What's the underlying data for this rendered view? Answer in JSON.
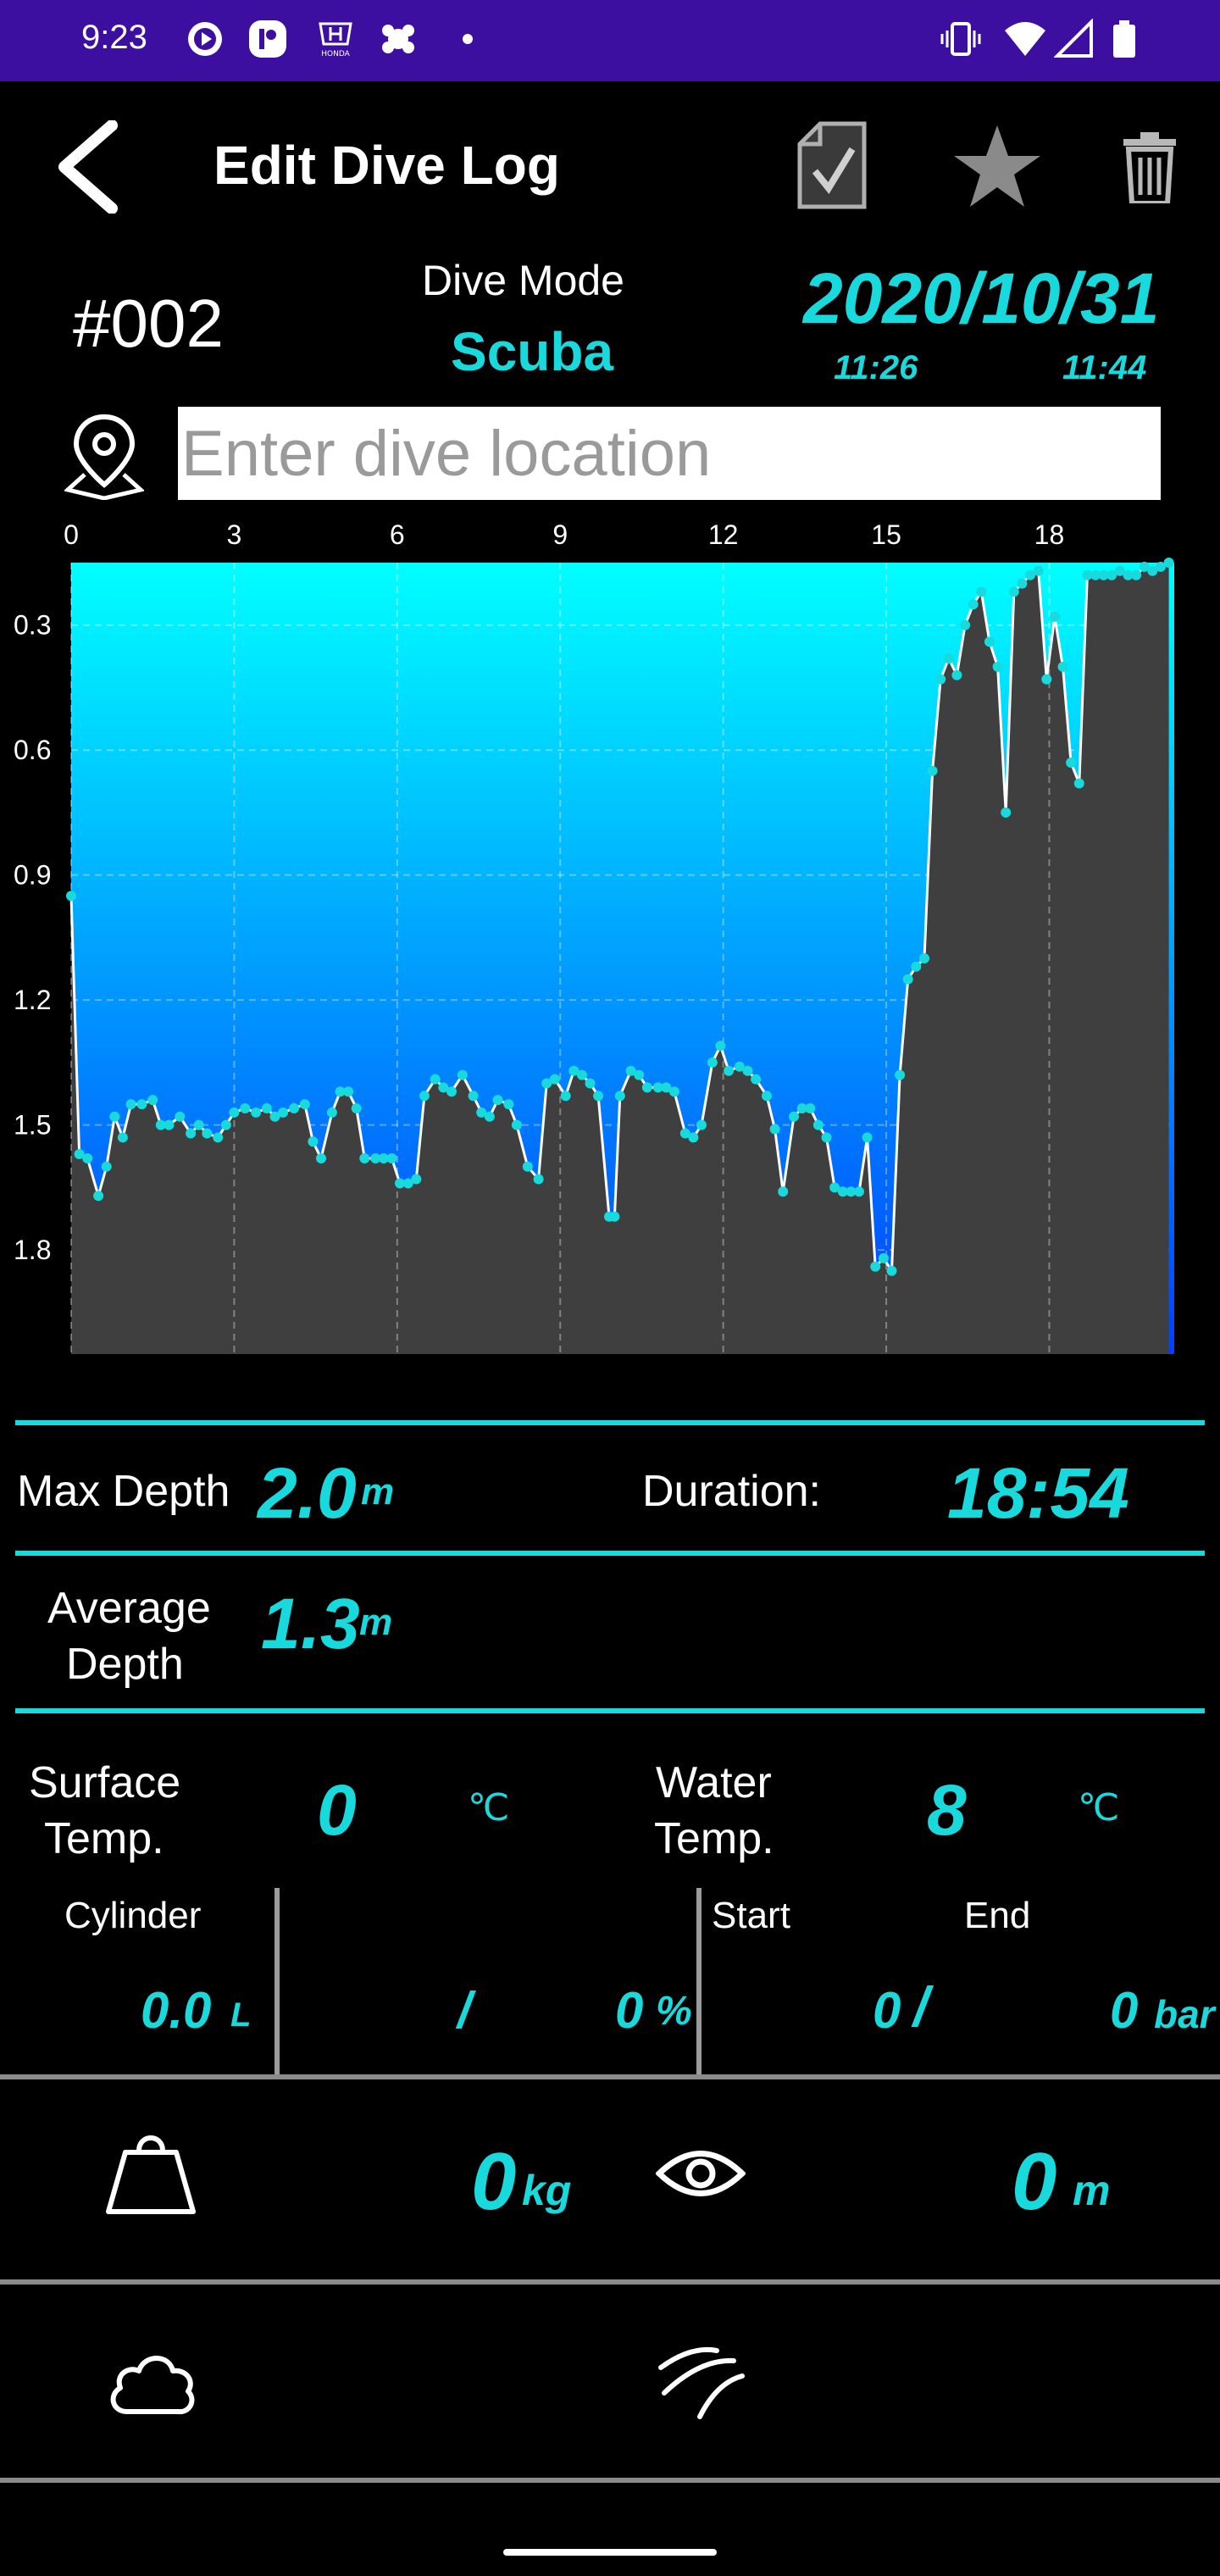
{
  "status_bar": {
    "time": "9:23",
    "left_icons": [
      "play-circle-icon",
      "app-r-icon",
      "honda-icon",
      "gear-blob-icon",
      "dot-icon"
    ],
    "right_icons": [
      "vibrate-icon",
      "wifi-icon",
      "signal-icon",
      "battery-icon"
    ]
  },
  "app_bar": {
    "title": "Edit Dive Log",
    "actions": [
      "back-arrow-icon",
      "save-check-icon",
      "star-icon",
      "trash-icon"
    ]
  },
  "dive": {
    "number": "#002",
    "mode_label": "Dive Mode",
    "mode_value": "Scuba",
    "date": "2020/10/31",
    "start_time": "11:26",
    "end_time": "11:44"
  },
  "location": {
    "placeholder": "Enter dive location",
    "value": ""
  },
  "chart_data": {
    "type": "area",
    "x_ticks": [
      "0",
      "3",
      "6",
      "9",
      "12",
      "15",
      "18"
    ],
    "y_ticks": [
      "0.3",
      "0.6",
      "0.9",
      "1.2",
      "1.5",
      "1.8"
    ],
    "xlim": [
      0,
      20.3
    ],
    "ylim": [
      0.15,
      2.05
    ],
    "y_inverted": true,
    "grid": true,
    "series": [
      {
        "x": [
          0,
          0.15,
          0.3,
          0.5,
          0.65,
          0.8,
          0.95,
          1.1,
          1.3,
          1.5,
          1.65,
          1.8,
          2.0,
          2.2,
          2.35,
          2.5,
          2.7,
          2.85,
          3.0,
          3.2,
          3.4,
          3.6,
          3.75,
          3.9,
          4.1,
          4.3,
          4.45,
          4.6,
          4.8,
          4.95,
          5.1,
          5.25,
          5.4,
          5.6,
          5.75,
          5.9,
          6.05,
          6.2,
          6.35,
          6.5,
          6.7,
          6.85,
          7.0,
          7.2,
          7.4,
          7.55,
          7.7,
          7.85,
          8.05,
          8.2,
          8.4,
          8.6,
          8.75,
          8.9,
          9.1,
          9.25,
          9.4,
          9.55,
          9.7,
          9.9,
          10.0,
          10.1,
          10.3,
          10.45,
          10.6,
          10.8,
          10.95,
          11.1,
          11.3,
          11.45,
          11.6,
          11.8,
          11.95,
          12.1,
          12.3,
          12.45,
          12.6,
          12.8,
          12.95,
          13.1,
          13.3,
          13.45,
          13.6,
          13.75,
          13.9,
          14.05,
          14.2,
          14.35,
          14.5,
          14.65,
          14.8,
          14.95,
          15.1,
          15.25,
          15.4,
          15.55,
          15.7,
          15.85,
          16.0,
          16.15,
          16.3,
          16.45,
          16.6,
          16.75,
          16.9,
          17.05,
          17.2,
          17.35,
          17.5,
          17.65,
          17.8,
          17.95,
          18.1,
          18.25,
          18.4,
          18.55,
          18.7,
          18.85,
          19.0,
          19.15,
          19.3,
          19.45,
          19.6,
          19.75,
          19.9,
          20.05,
          20.2
        ],
        "y": [
          0.95,
          1.57,
          1.58,
          1.67,
          1.6,
          1.48,
          1.53,
          1.45,
          1.45,
          1.44,
          1.5,
          1.5,
          1.48,
          1.52,
          1.5,
          1.52,
          1.53,
          1.5,
          1.47,
          1.46,
          1.47,
          1.46,
          1.48,
          1.47,
          1.46,
          1.45,
          1.54,
          1.58,
          1.47,
          1.42,
          1.42,
          1.46,
          1.58,
          1.58,
          1.58,
          1.58,
          1.64,
          1.64,
          1.63,
          1.43,
          1.39,
          1.41,
          1.42,
          1.38,
          1.43,
          1.47,
          1.48,
          1.44,
          1.45,
          1.5,
          1.6,
          1.63,
          1.4,
          1.39,
          1.43,
          1.37,
          1.38,
          1.4,
          1.43,
          1.72,
          1.72,
          1.43,
          1.37,
          1.38,
          1.41,
          1.41,
          1.41,
          1.42,
          1.52,
          1.53,
          1.5,
          1.35,
          1.31,
          1.37,
          1.36,
          1.37,
          1.39,
          1.43,
          1.51,
          1.66,
          1.48,
          1.46,
          1.46,
          1.5,
          1.53,
          1.65,
          1.66,
          1.66,
          1.66,
          1.53,
          1.84,
          1.82,
          1.85,
          1.38,
          1.15,
          1.12,
          1.1,
          0.65,
          0.43,
          0.38,
          0.42,
          0.3,
          0.25,
          0.22,
          0.34,
          0.4,
          0.75,
          0.22,
          0.2,
          0.18,
          0.17,
          0.43,
          0.28,
          0.4,
          0.63,
          0.68,
          0.18,
          0.18,
          0.18,
          0.18,
          0.17,
          0.18,
          0.18,
          0.16,
          0.17,
          0.16,
          0.15
        ]
      }
    ]
  },
  "stats": {
    "max_depth_label": "Max Depth",
    "max_depth_value": "2.0",
    "max_depth_unit": "m",
    "duration_label": "Duration:",
    "duration_value": "18:54",
    "avg_depth_label_1": "Average",
    "avg_depth_label_2": "Depth",
    "avg_depth_value": "1.3",
    "avg_depth_unit": "m",
    "surface_temp_label_1": "Surface",
    "surface_temp_label_2": "Temp.",
    "surface_temp_value": "0",
    "surface_temp_unit": "℃",
    "water_temp_label_1": "Water",
    "water_temp_label_2": "Temp.",
    "water_temp_value": "8",
    "water_temp_unit": "℃"
  },
  "cylinder": {
    "label": "Cylinder",
    "volume": "0.0",
    "volume_unit": "L",
    "slash": "/",
    "percent": "0",
    "percent_unit": "%",
    "start_label": "Start",
    "end_label": "End",
    "start_value": "0",
    "end_value": "0",
    "pressure_unit": "bar"
  },
  "conditions": {
    "weight_icon": "weight-icon",
    "weight_value": "0",
    "weight_unit": "kg",
    "visibility_icon": "eye-icon",
    "visibility_value": "0",
    "visibility_unit": "m",
    "weather_icon": "cloud-icon",
    "current_icon": "wind-icon"
  },
  "colors": {
    "status_bar": "#3d0fa0",
    "accent": "#18d9dc",
    "chart_top": "#00ffff",
    "chart_bottom": "#0040ff",
    "chart_ground": "#3f3f3f"
  }
}
